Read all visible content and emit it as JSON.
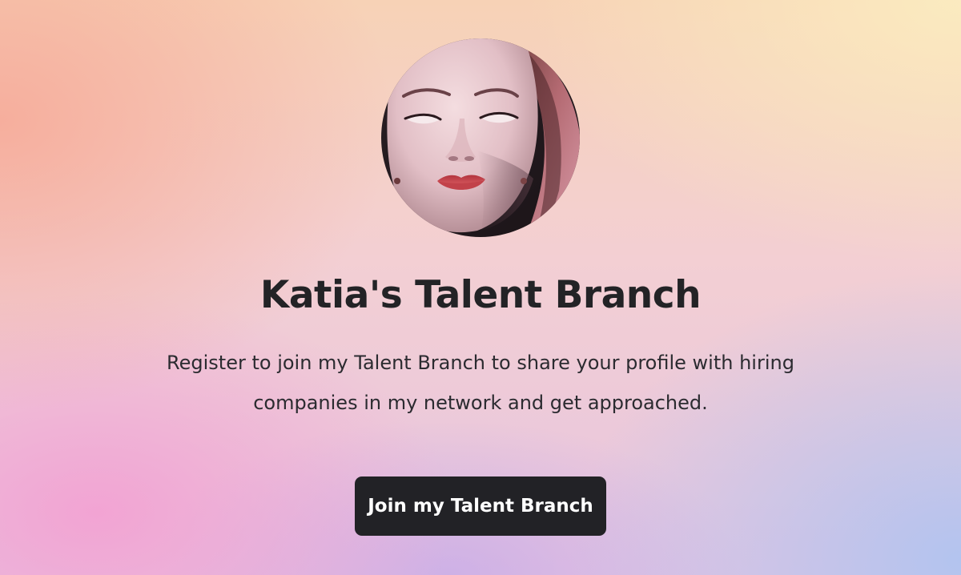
{
  "profile": {
    "avatar_alt": "Profile photo of Katia"
  },
  "hero": {
    "title": "Katia's Talent Branch",
    "description": "Register to join my Talent Branch to share your profile with hiring companies in my network and get approached.",
    "cta_label": "Join my Talent Branch"
  }
}
